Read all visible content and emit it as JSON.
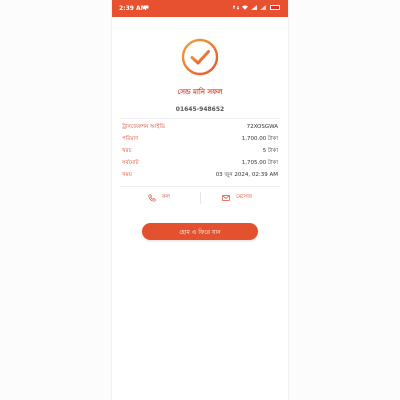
{
  "status_bar": {
    "time": "2:39 AM",
    "icons": [
      "chat-icon",
      "data-icon",
      "wifi-icon",
      "signal-icon",
      "signal-icon",
      "battery-icon"
    ]
  },
  "success": {
    "icon": "check-circle-icon",
    "title": "সেন্ড মানি সফল",
    "phone_number": "01645-948652"
  },
  "details": [
    {
      "label": "ট্রানজেকশন আইডি",
      "value": "72XOSGWA"
    },
    {
      "label": "পরিমাণ",
      "value": "1,700.00 টাকা"
    },
    {
      "label": "খরচ",
      "value": "5 টাকা"
    },
    {
      "label": "সর্বমোট",
      "value": "1,705.00 টাকা"
    },
    {
      "label": "সময়",
      "value": "03 জুন 2024, 02:39 AM"
    }
  ],
  "actions": {
    "call_label": "কল",
    "message_label": "মেসেজ"
  },
  "home_button_label": "হোম এ ফিরে যান",
  "colors": {
    "accent": "#e8512f",
    "label": "#d84428",
    "check_gradient_start": "#f0a23a",
    "check_gradient_end": "#e5552c"
  }
}
